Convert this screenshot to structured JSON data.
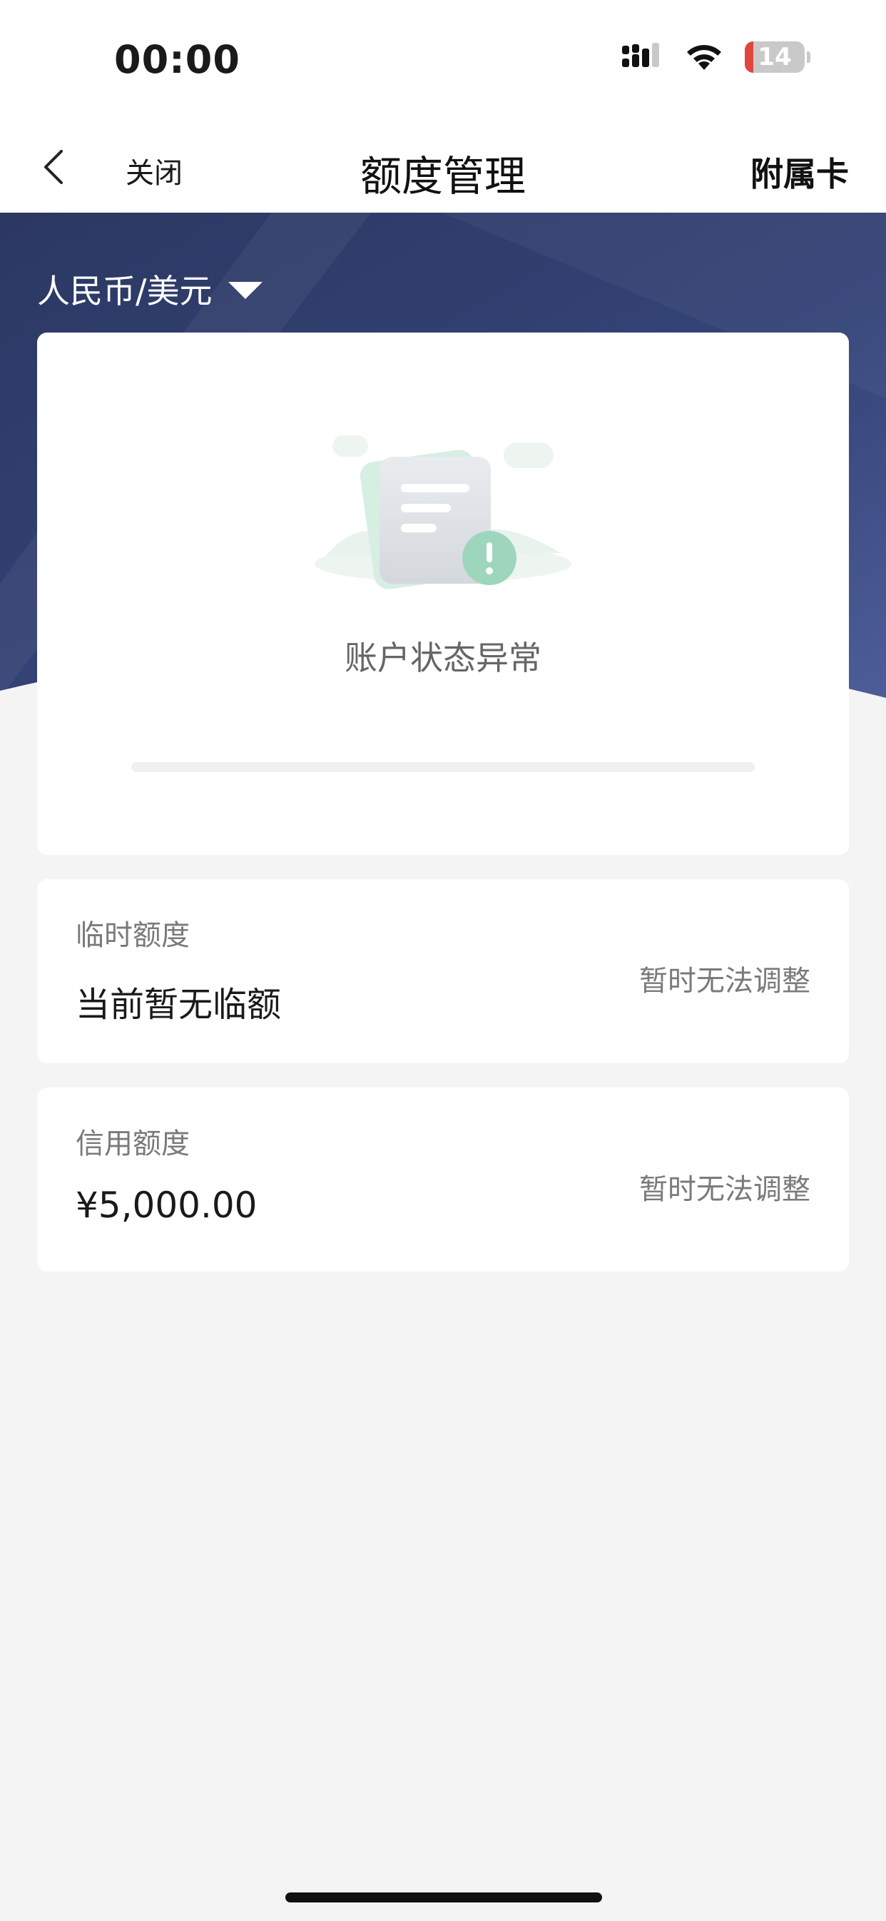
{
  "status_bar": {
    "time": "00:00",
    "battery": "14",
    "battery_level": 0.14
  },
  "nav": {
    "close_label": "关闭",
    "title": "额度管理",
    "right_label": "附属卡"
  },
  "currency": {
    "selected": "人民币/美元"
  },
  "account_status": {
    "message": "账户状态异常"
  },
  "temp_limit": {
    "label": "临时额度",
    "value": "当前暂无临额",
    "action": "暂时无法调整"
  },
  "credit_limit": {
    "label": "信用额度",
    "value": "¥5,000.00",
    "action": "暂时无法调整"
  },
  "colors": {
    "hero_dark": "#2d3a66",
    "hero_light": "#4a5a94",
    "page_bg": "#f4f4f4",
    "battery_low": "#e0463b"
  }
}
